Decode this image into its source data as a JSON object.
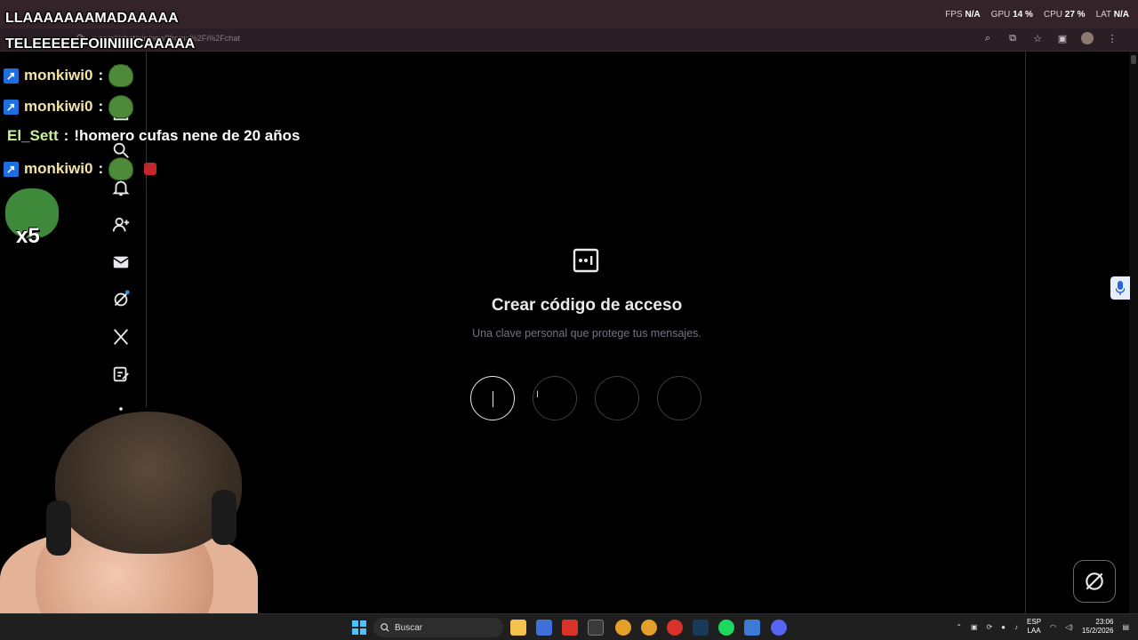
{
  "browser": {
    "url": "x.com/i/chat/pin/new?from=%2Fi%2Fchat",
    "nav_arrows": "← → ⟳"
  },
  "perf_overlay": {
    "fps_label": "FPS",
    "fps_value": "N/A",
    "gpu_label": "GPU",
    "gpu_value": "14 %",
    "cpu_label": "CPU",
    "cpu_value": "27 %",
    "lat_label": "LAT",
    "lat_value": "N/A"
  },
  "stream_overlay": {
    "alert_line_1": "LLAAAAAAAMADAAAAA",
    "alert_line_2": "TELEEEEEFOIINIIIICAAAAA",
    "chat": [
      {
        "user": "monkiwi0",
        "message": "",
        "badge": true
      },
      {
        "user": "monkiwi0",
        "message": "",
        "badge": true
      },
      {
        "user": "El_Sett",
        "message": "!homero cufas nene de 20 años",
        "badge": false
      },
      {
        "user": "monkiwi0",
        "message": "",
        "badge": true
      }
    ],
    "separator": ":",
    "multiplier": "x5"
  },
  "sidebar": {
    "icons": [
      "x-logo-icon",
      "home-icon",
      "search-icon",
      "bell-icon",
      "add-user-icon",
      "mail-icon",
      "grok-icon",
      "x-premium-icon",
      "compose-icon",
      "more-icon"
    ]
  },
  "passcode": {
    "title": "Crear código de acceso",
    "subtitle": "Una clave personal que protege tus mensajes.",
    "digits": 4,
    "active_index": 0
  },
  "taskbar": {
    "search_placeholder": "Buscar",
    "lang_1": "ESP",
    "lang_2": "LAA",
    "time": "23:06",
    "date": "15/2/2026"
  },
  "colors": {
    "background": "#000000",
    "text_primary": "#e7e9ea",
    "text_secondary": "#71767b",
    "chrome": "#35232a",
    "accent": "#1d9bf0"
  }
}
